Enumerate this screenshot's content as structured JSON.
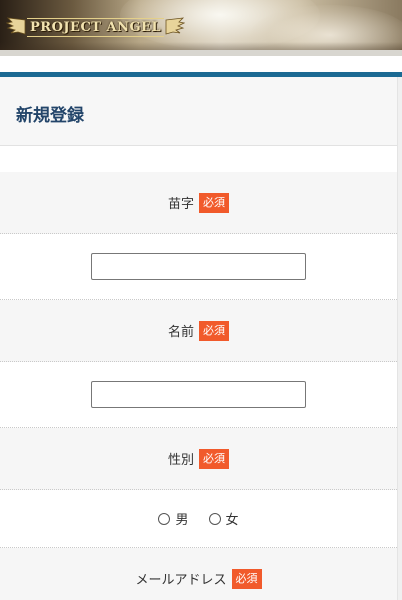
{
  "banner": {
    "logo_text": "PROJECT ANGEL"
  },
  "page": {
    "title": "新規登録"
  },
  "form": {
    "required_badge": "必須",
    "last_name": {
      "label": "苗字",
      "value": ""
    },
    "first_name": {
      "label": "名前",
      "value": ""
    },
    "gender": {
      "label": "性別",
      "options": [
        "男",
        "女"
      ]
    },
    "email": {
      "label": "メールアドレス"
    }
  },
  "colors": {
    "accent_line": "#1b6a93",
    "required_badge": "#f15a2b",
    "title_text": "#23456a"
  }
}
